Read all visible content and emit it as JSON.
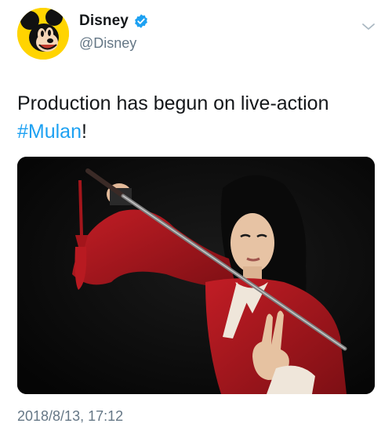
{
  "author": {
    "display_name": "Disney",
    "handle": "@Disney",
    "verified": true,
    "avatar_icon": "mickey-mouse-avatar",
    "avatar_bg": "#ffd400"
  },
  "tweet": {
    "text_before": "Production has begun on live-action ",
    "hashtag": "#Mulan",
    "text_after": "!",
    "media_description_icon": "mulan-promo-photo",
    "timestamp": "2018/8/13, 17:12"
  },
  "colors": {
    "link": "#1da1f2",
    "secondary_text": "#657786",
    "primary_text": "#14171a",
    "verified_badge": "#1da1f2"
  },
  "icons": {
    "verified": "verified-badge-icon",
    "menu": "chevron-down-icon"
  }
}
